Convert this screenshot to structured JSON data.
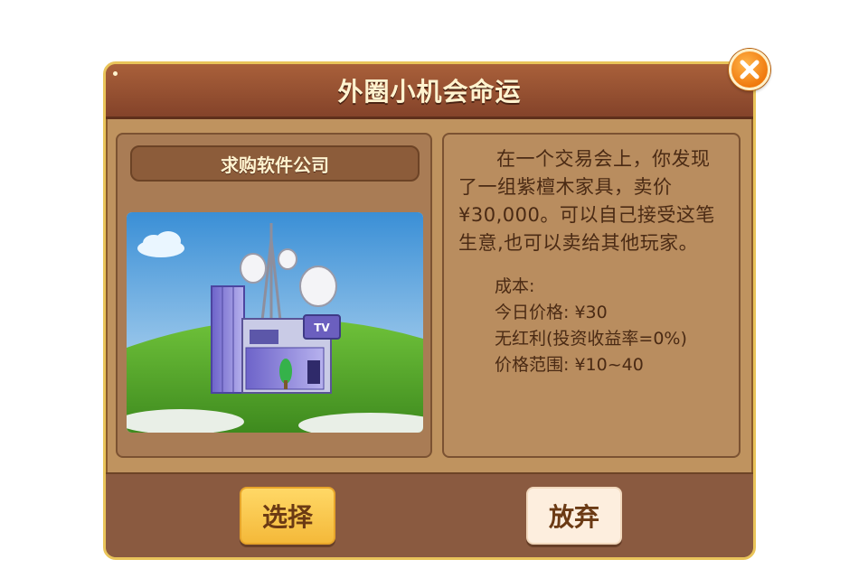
{
  "dialog": {
    "title": "外圈小机会命运"
  },
  "card": {
    "name": "求购软件公司",
    "image_icon": "building-with-tv-antenna-illustration",
    "tv_sign": "TV"
  },
  "info": {
    "description": "在一个交易会上，你发现了一组紫檀木家具，卖价¥30,000。可以自己接受这笔生意,也可以卖给其他玩家。",
    "stats": [
      "成本:",
      "今日价格: ¥30",
      "无红利(投资收益率=0%)",
      "价格范围: ¥10~40"
    ]
  },
  "buttons": {
    "select_label": "选择",
    "abandon_label": "放弃"
  },
  "colors": {
    "title_bar": "#84432a",
    "panel": "#bf935f",
    "select_button": "#f4b93a",
    "abandon_button": "#fdeede",
    "close_button": "#f07a0e",
    "text": "#4a2a14"
  }
}
